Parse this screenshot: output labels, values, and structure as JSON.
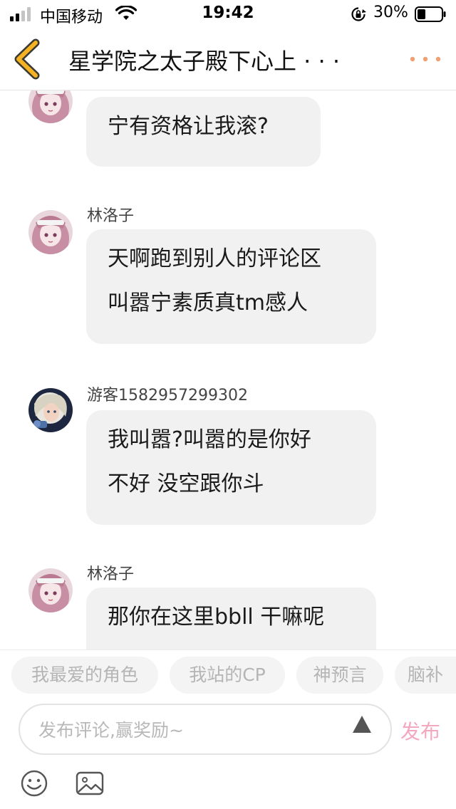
{
  "status_bar": {
    "carrier": "中国移动",
    "time": "19:42",
    "battery": "30%",
    "icons": [
      "signal-icon",
      "wifi-icon",
      "rotation-lock-icon",
      "battery-icon"
    ]
  },
  "nav": {
    "title": "星学院之太子殿下心上 · · ·",
    "back_icon": "chevron-left-icon",
    "more_icon": "more-dots-icon",
    "accent_color": "#f5b324"
  },
  "messages": [
    {
      "username": "",
      "lines": [
        "宁有资格让我滚?"
      ],
      "avatar": "anime-girl-avatar"
    },
    {
      "username": "林洛子",
      "lines": [
        "天啊跑到别人的评论区",
        "叫嚣宁素质真tm感人"
      ],
      "avatar": "anime-girl-avatar"
    },
    {
      "username": "游客1582957299302",
      "lines": [
        "我叫嚣?叫嚣的是你好",
        "不好 没空跟你斗"
      ],
      "avatar": "blonde-character-avatar"
    },
    {
      "username": "林洛子",
      "lines": [
        "那你在这里bbll 干嘛呢"
      ],
      "avatar": "anime-girl-avatar"
    }
  ],
  "chips": [
    "我最爱的角色",
    "我站的CP",
    "神预言",
    "脑补"
  ],
  "comment": {
    "placeholder": "发布评论,赢奖励~",
    "send_icon": "triangle-up-icon",
    "publish_label": "发布",
    "publish_color": "#f4a8c0"
  },
  "toolbar": {
    "emoji_icon": "emoji-icon",
    "image_icon": "image-icon"
  }
}
